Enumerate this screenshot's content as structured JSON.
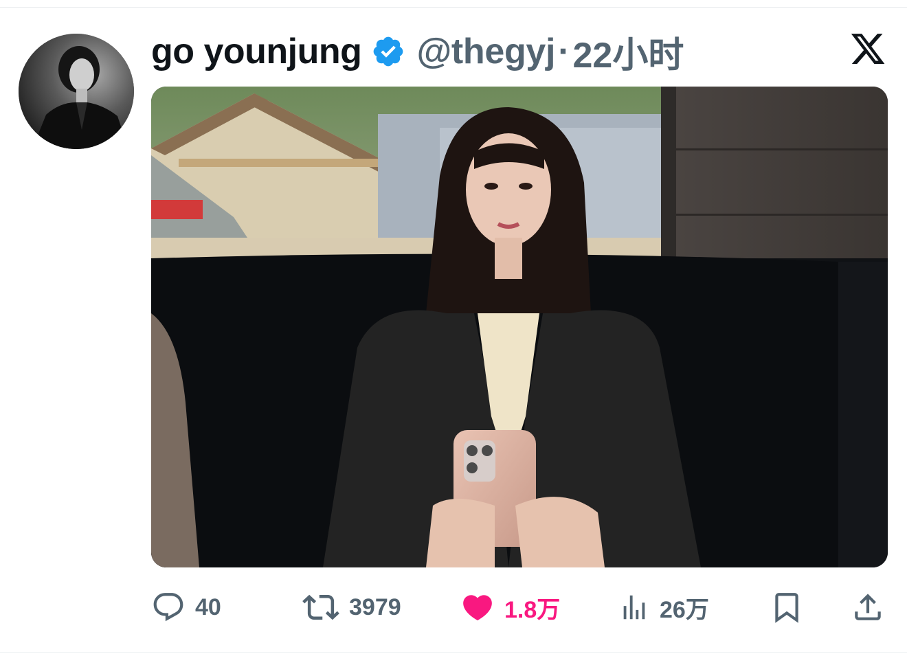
{
  "tweet": {
    "author": {
      "display_name": "go younjung",
      "handle": "@thegyj",
      "verified": true
    },
    "separator": "·",
    "time": "22小时",
    "media": {
      "alt_icon": "photo-media"
    },
    "actions": {
      "reply": {
        "icon": "reply-icon",
        "count": "40"
      },
      "retweet": {
        "icon": "retweet-icon",
        "count": "3979"
      },
      "like": {
        "icon": "heart-icon",
        "count": "1.8万",
        "active": true
      },
      "views": {
        "icon": "views-icon",
        "count": "26万"
      },
      "bookmark": {
        "icon": "bookmark-icon"
      },
      "share": {
        "icon": "share-icon"
      }
    }
  },
  "colors": {
    "text_primary": "#0f1419",
    "text_secondary": "#536471",
    "verified_blue": "#1d9bf0",
    "like_pink": "#f91880"
  }
}
